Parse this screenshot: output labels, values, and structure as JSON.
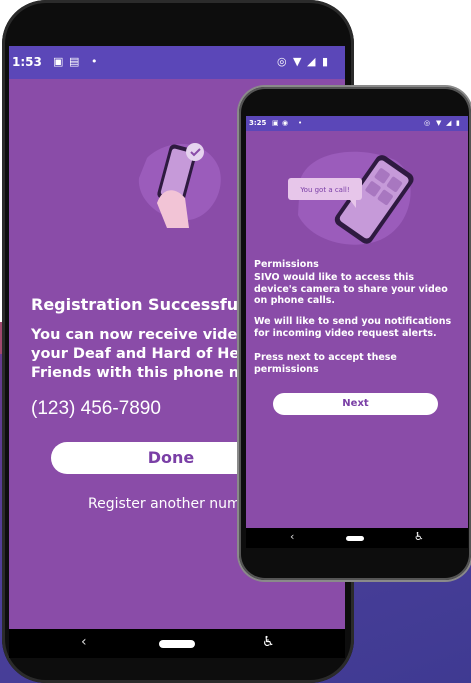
{
  "phone1": {
    "status": {
      "time": "1:53"
    },
    "title": "Registration Successful",
    "body": "You can now receive videos from your Deaf and Hard of Hearing Friends with this phone number",
    "phone_number": "(123) 456-7890",
    "done_label": "Done",
    "register_label": "Register another number"
  },
  "phone2": {
    "status": {
      "time": "3:25"
    },
    "bubble": "You got a call!",
    "title": "Permissions",
    "line1": "SIVO would like to access this device's camera to share your video on phone calls.",
    "line2": "We will like to send you notifications for incoming video request alerts.",
    "line3": "Press next to accept these permissions",
    "next_label": "Next"
  },
  "colors": {
    "screen": "#8a4ca8",
    "statusbar": "#5b47b8",
    "button_text": "#7a3fa6"
  }
}
